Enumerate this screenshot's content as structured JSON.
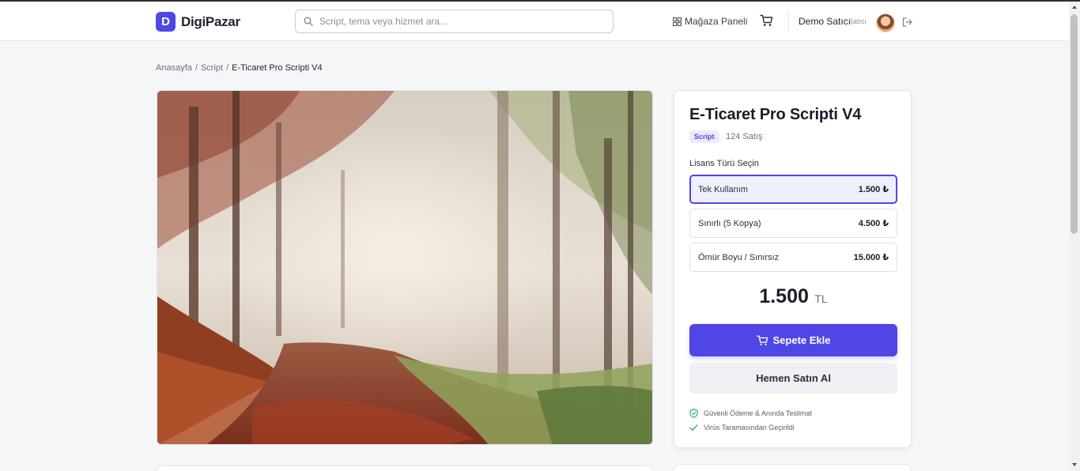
{
  "header": {
    "logo_letter": "D",
    "logo_text": "DigiPazar",
    "search_placeholder": "Script, tema veya hizmet ara...",
    "store_panel_label": "Mağaza Paneli",
    "user_name": "Demo Satıcı",
    "user_role": "Satıcı"
  },
  "breadcrumb": {
    "home": "Anasayfa",
    "sep1": "/",
    "category": "Script",
    "sep2": "/",
    "current": "E-Ticaret Pro Scripti V4"
  },
  "product": {
    "title": "E-Ticaret Pro Scripti V4",
    "category_badge": "Script",
    "sales": "124 Satış",
    "license_label": "Lisans Türü Seçin",
    "licenses": [
      {
        "name": "Tek Kullanım",
        "price": "1.500 ₺",
        "selected": true
      },
      {
        "name": "Sınırlı (5 Kopya)",
        "price": "4.500 ₺",
        "selected": false
      },
      {
        "name": "Ömür Boyu / Sınırsız",
        "price": "15.000 ₺",
        "selected": false
      }
    ],
    "total_amount": "1.500",
    "total_currency": "TL",
    "add_to_cart_label": "Sepete Ekle",
    "buy_now_label": "Hemen Satın Al",
    "trust": [
      "Güvenli Ödeme & Anında Teslimat",
      "Virüs Taramasından Geçirildi"
    ]
  },
  "colors": {
    "accent": "#4f46e5",
    "success": "#22a55b"
  },
  "icons": [
    "search-icon",
    "grid-icon",
    "cart-icon",
    "logout-icon",
    "shield-check-icon",
    "check-icon"
  ]
}
